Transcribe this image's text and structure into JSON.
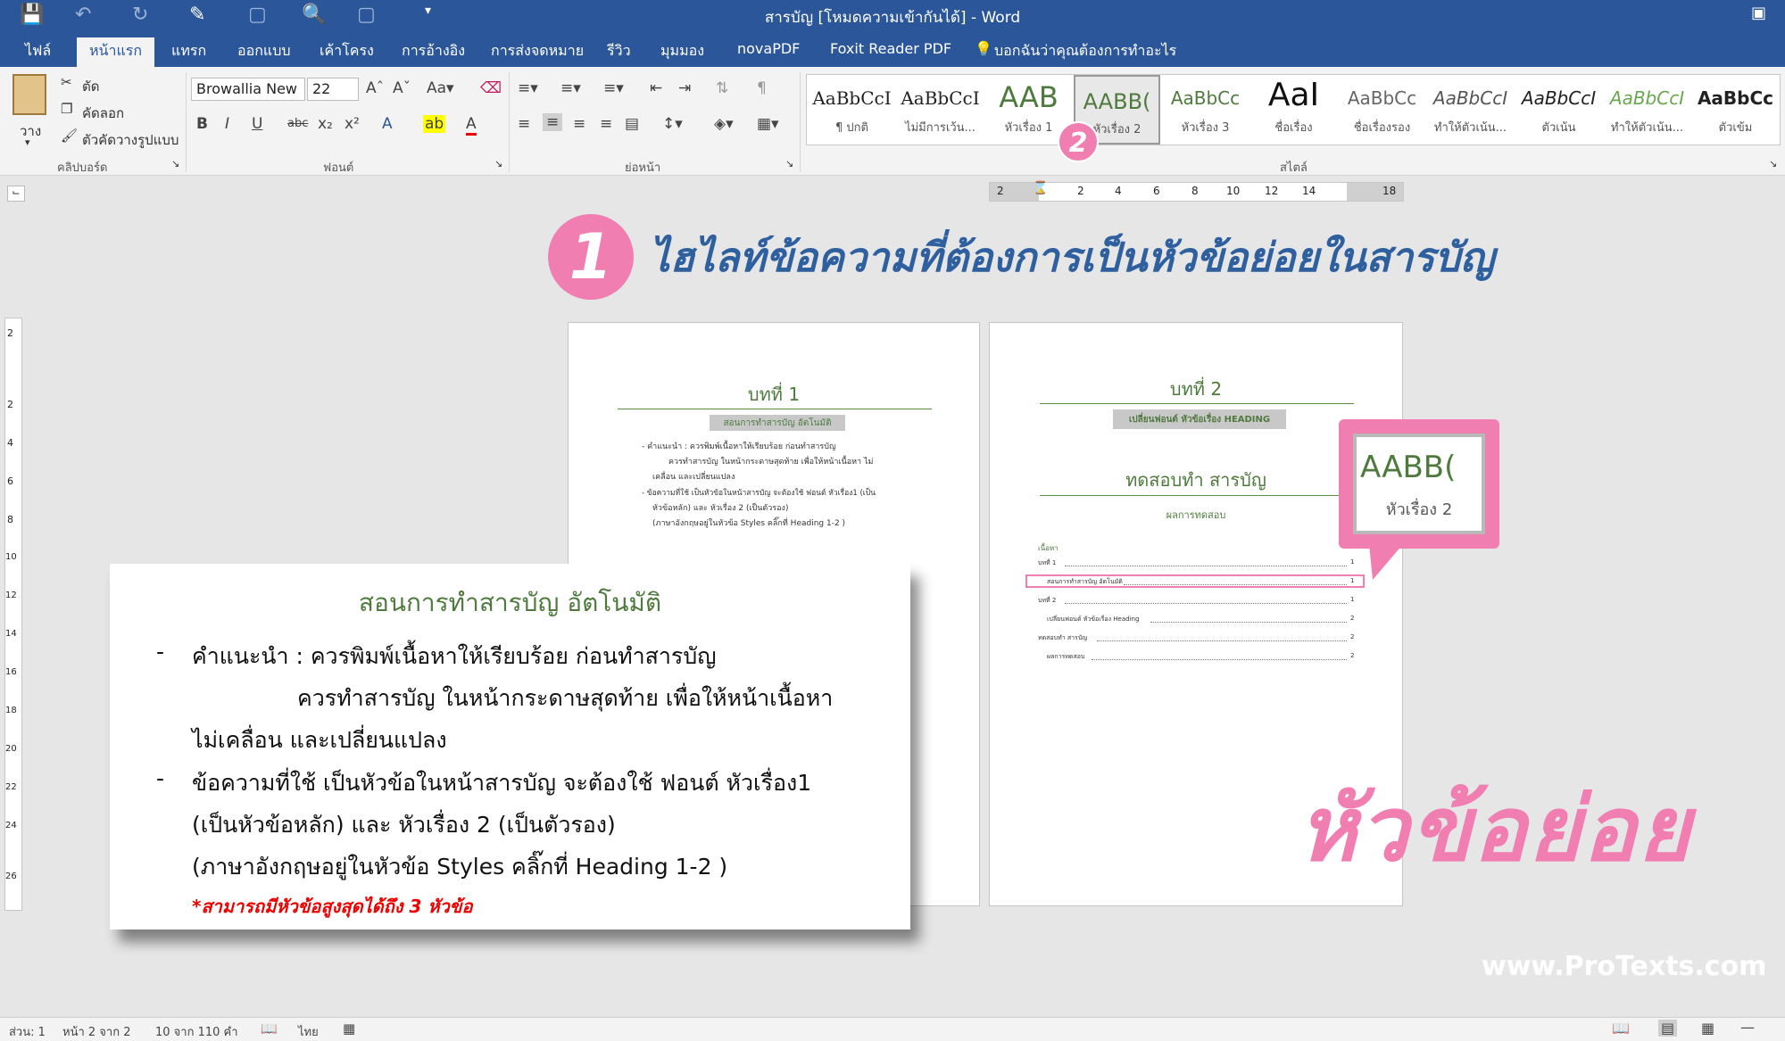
{
  "window": {
    "title": "สารบัญ [โหมดความเข้ากันได้] - Word"
  },
  "ribbon_tabs": [
    "ไฟล์",
    "หน้าแรก",
    "แทรก",
    "ออกแบบ",
    "เค้าโครง",
    "การอ้างอิง",
    "การส่งจดหมาย",
    "รีวิว",
    "มุมมอง",
    "novaPDF",
    "Foxit Reader PDF",
    "บอกฉันว่าคุณต้องการทำอะไร"
  ],
  "clipboard": {
    "paste": "วาง",
    "cut": "ตัด",
    "copy": "คัดลอก",
    "format_painter": "ตัวคัดวางรูปแบบ",
    "group": "คลิปบอร์ด"
  },
  "font": {
    "name": "Browallia New",
    "size": "22",
    "group": "ฟอนต์"
  },
  "paragraph": {
    "group": "ย่อหน้า"
  },
  "styles": {
    "group": "สไตล์",
    "items": [
      {
        "preview": "AaBbCcI",
        "name": "¶ ปกติ"
      },
      {
        "preview": "AaBbCcI",
        "name": "ไม่มีการเว้น..."
      },
      {
        "preview": "AAB",
        "name": "หัวเรื่อง 1"
      },
      {
        "preview": "AABB(",
        "name": "หัวเรื่อง 2"
      },
      {
        "preview": "AaBbCc",
        "name": "หัวเรื่อง 3"
      },
      {
        "preview": "AaI",
        "name": "ชื่อเรื่อง"
      },
      {
        "preview": "AaBbCc",
        "name": "ชื่อเรื่องรอง"
      },
      {
        "preview": "AaBbCcI",
        "name": "ทำให้ตัวเน้น..."
      },
      {
        "preview": "AaBbCcI",
        "name": "ตัวเน้น"
      },
      {
        "preview": "AaBbCcI",
        "name": "ทำให้ตัวเน้น..."
      },
      {
        "preview": "AaBbCc",
        "name": "ตัวเข้ม"
      }
    ]
  },
  "ruler": {
    "marks": [
      "2",
      "2",
      "4",
      "6",
      "8",
      "10",
      "12",
      "14",
      "18"
    ],
    "vmarks": [
      "2",
      "2",
      "4",
      "6",
      "8",
      "10",
      "12",
      "14",
      "16",
      "18",
      "20",
      "22",
      "24",
      "26"
    ]
  },
  "callouts": {
    "step1_num": "1",
    "step1_text": "ไฮไลท์ข้อความที่ต้องการเป็นหัวข้อย่อยในสารบัญ",
    "step2_num": "2",
    "zoom_preview": "AABB(",
    "zoom_label": "หัวเรื่อง 2",
    "subheading": "หัวข้อย่อย",
    "website": "www.ProTexts.com"
  },
  "page1": {
    "chapter": "บทที่ 1",
    "highlight": "สอนการทำสารบัญ อัตโนมัติ",
    "lines": [
      "- คำแนะนำ : ควรพิมพ์เนื้อหาให้เรียบร้อย ก่อนทำสารบัญ",
      "ควรทำสารบัญ ในหน้ากระดาษสุดท้าย เพื่อให้หน้าเนื้อหา ไม่",
      "เคลื่อน และเปลี่ยนแปลง",
      "- ข้อความที่ใช้ เป็นหัวข้อในหน้าสารบัญ จะต้องใช้ ฟอนต์ หัวเรื่อง1 (เป็น",
      "หัวข้อหลัก) และ หัวเรื่อง 2 (เป็นตัวรอง)",
      "(ภาษาอังกฤษอยู่ในหัวข้อ Styles คลิ๊กที่ Heading 1-2 )"
    ]
  },
  "page2": {
    "chapter": "บทที่ 2",
    "highlight": "เปลี่ยนฟอนต์ หัวข้อเรื่อง HEADING",
    "test_title": "ทดสอบทำ สารบัญ",
    "test_sub": "ผลการทดสอบ",
    "toc_title": "เนื้อหา",
    "toc": [
      {
        "text": "บทที่ 1",
        "page": "1"
      },
      {
        "text": "สอนการทำสารบัญ อัตโนมัติ",
        "page": "1"
      },
      {
        "text": "บทที่ 2",
        "page": "1"
      },
      {
        "text": "เปลี่ยนฟอนต์ หัวข้อเรื่อง Heading",
        "page": "2"
      },
      {
        "text": "ทดสอบทำ สารบัญ",
        "page": "2"
      },
      {
        "text": "ผลการทดสอบ",
        "page": "2"
      }
    ]
  },
  "enlarged": {
    "title": "สอนการทำสารบัญ อัตโนมัติ",
    "dash": "-",
    "l1": "คำแนะนำ : ควรพิมพ์เนื้อหาให้เรียบร้อย ก่อนทำสารบัญ",
    "l2": "ควรทำสารบัญ ในหน้ากระดาษสุดท้าย เพื่อให้หน้าเนื้อหา",
    "l3": "ไม่เคลื่อน และเปลี่ยนแปลง",
    "l4": "ข้อความที่ใช้ เป็นหัวข้อในหน้าสารบัญ จะต้องใช้ ฟอนต์ หัวเรื่อง1",
    "l5": "(เป็นหัวข้อหลัก) และ หัวเรื่อง 2 (เป็นตัวรอง)",
    "l6": "(ภาษาอังกฤษอยู่ในหัวข้อ Styles คลิ๊กที่ Heading 1-2 )",
    "note": "*สามารถมีหัวข้อสูงสุดได้ถึง 3 หัวข้อ"
  },
  "status": {
    "section": "ส่วน: 1",
    "page": "หน้า 2 จาก 2",
    "words": "10 จาก 110 คำ",
    "lang": "ไทย"
  },
  "colors": {
    "brand": "#2b579a",
    "accent_pink": "#f07eb0",
    "heading_green": "#4f7a3e",
    "step_text_blue": "#2e5f9e"
  }
}
